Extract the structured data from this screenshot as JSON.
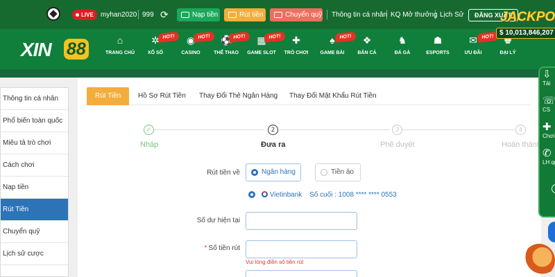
{
  "topbar": {
    "live": "LIVE",
    "username": "myhan2020",
    "balance": "999",
    "deposit": "Nạp tiền",
    "withdraw": "Rút tiền",
    "transfer": "Chuyển quỹ",
    "personal_info": "Thông tin cá nhân",
    "results": "KQ Mở thưởng",
    "history": "Lịch Sử",
    "logout": "ĐĂNG XUẤT"
  },
  "brand": {
    "logo_word": "XIN",
    "logo_number": "88"
  },
  "jackpot": {
    "title": "JACKPOT",
    "amount": "$ 10,013,846,207"
  },
  "nav": {
    "items": [
      {
        "label": "TRANG CHỦ",
        "icon": "home-icon"
      },
      {
        "label": "XỔ SỐ",
        "icon": "lottery-icon",
        "badge": "HOT!"
      },
      {
        "label": "CASINO",
        "icon": "casino-chip-icon",
        "badge": "HOT!"
      },
      {
        "label": "THỂ THAO",
        "icon": "soccer-icon",
        "badge": "HOT!"
      },
      {
        "label": "GAME SLOT",
        "icon": "slot-machine-icon",
        "badge": "HOT!"
      },
      {
        "label": "TRÒ CHƠI",
        "icon": "gamepad-icon"
      },
      {
        "label": "GAME BÀI",
        "icon": "cards-icon",
        "badge": "HOT!"
      },
      {
        "label": "BẮN CÁ",
        "icon": "fish-icon"
      },
      {
        "label": "ĐÁ GÀ",
        "icon": "rooster-icon"
      },
      {
        "label": "ESPORTS",
        "icon": "esports-icon"
      },
      {
        "label": "ƯU ĐÃI",
        "icon": "gift-icon"
      },
      {
        "label": "ĐẠI LÝ",
        "icon": "agent-icon",
        "badge": "HOT!"
      }
    ]
  },
  "sidebar": {
    "items": [
      {
        "label": "Thông tin cá nhân"
      },
      {
        "label": "Phổ biến toàn quốc"
      },
      {
        "label": "Miêu tả trò chơi"
      },
      {
        "label": "Cách chơi"
      },
      {
        "label": "Nạp tiền"
      },
      {
        "label": "Rút Tiền",
        "active": true
      },
      {
        "label": "Chuyển quỹ"
      },
      {
        "label": "Lịch sử cược"
      }
    ]
  },
  "tabs": [
    {
      "label": "Rút Tiền",
      "active": true
    },
    {
      "label": "Hồ Sơ Rút Tiền"
    },
    {
      "label": "Thay Đổi Thẻ Ngân Hàng"
    },
    {
      "label": "Thay Đổi Mật Khẩu Rút Tiền"
    }
  ],
  "steps": [
    {
      "number": "✓",
      "label": "Nháp",
      "state": "done"
    },
    {
      "number": "2",
      "label": "Đưa ra",
      "state": "current"
    },
    {
      "number": "3",
      "label": "Phê duyệt",
      "state": "pending"
    },
    {
      "number": "4",
      "label": "Hoàn thành",
      "state": "pending"
    }
  ],
  "form": {
    "withdraw_to_label": "Rút tiền về",
    "option_bank": "Ngân hàng",
    "option_crypto": "Tiền ảo",
    "bank_name": "Vietinbank",
    "bank_suffix": "Số cuối : 1008 **** **** 0553",
    "balance_label": "Số dư hiện tại",
    "balance_value": "",
    "amount_required_mark": "*",
    "amount_label": "Số tiền rút",
    "amount_value": "",
    "amount_error": "Vui lòng điền số tiền rút"
  },
  "right_panel": {
    "items": [
      {
        "label": "Tải",
        "icon": "download-icon"
      },
      {
        "label": "CS",
        "icon": "support-icon"
      },
      {
        "label": "Chơi",
        "icon": "gamepad-icon"
      },
      {
        "label": "LH qu",
        "icon": "phone-icon"
      }
    ],
    "close": "×"
  },
  "colors": {
    "header_green": "#166a2f",
    "nav_green": "#0f7f3b",
    "accent_orange": "#f3ad3c",
    "active_blue": "#2c73b8",
    "error_red": "#e2363a",
    "done_green": "#7bc47f"
  }
}
